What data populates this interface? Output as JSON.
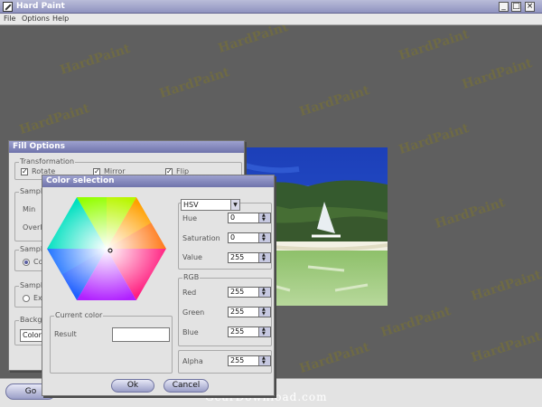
{
  "app": {
    "title": "Hard Paint"
  },
  "window_controls": {
    "minimize": "_",
    "maximize": "□",
    "close": "×"
  },
  "menu": [
    "File",
    "Options",
    "Help"
  ],
  "watermark_text": "HardPaint",
  "footer": {
    "brand": "GearDownload.com"
  },
  "bottom_bar": {
    "go_label": "Go"
  },
  "fill_options": {
    "title": "Fill Options",
    "transformation": {
      "label": "Transformation",
      "rotate": {
        "label": "Rotate",
        "checked": true
      },
      "mirror": {
        "label": "Mirror",
        "checked": true
      },
      "flip": {
        "label": "Flip",
        "checked": true
      }
    },
    "sample_size": {
      "label": "Sample",
      "min_label": "Min",
      "overlap_label": "Overl"
    },
    "sample_source": {
      "label": "Sample",
      "option": "Co"
    },
    "sample_ext": {
      "label": "Sample",
      "option": "Ex"
    },
    "background": {
      "label": "Backgr",
      "value": "Color"
    }
  },
  "color_selection": {
    "title": "Color selection",
    "mode": "HSV",
    "hsv": {
      "hue_label": "Hue",
      "hue": "0",
      "saturation_label": "Saturation",
      "saturation": "0",
      "value_label": "Value",
      "value": "255"
    },
    "rgb": {
      "label": "RGB",
      "red_label": "Red",
      "red": "255",
      "green_label": "Green",
      "green": "255",
      "blue_label": "Blue",
      "blue": "255"
    },
    "alpha_label": "Alpha",
    "alpha": "255",
    "current_color": {
      "label": "Current color",
      "result_label": "Result",
      "result_color": "#ffffff"
    },
    "ok_label": "Ok",
    "cancel_label": "Cancel"
  },
  "colors": {
    "title_bar": "#8f93bf",
    "dialog_bg": "#e3e3e3",
    "canvas_bg": "#5f5f5f"
  },
  "icons": [
    "app-icon",
    "dropdown-arrow-icon",
    "spin-up-icon",
    "spin-down-icon",
    "check-icon"
  ]
}
